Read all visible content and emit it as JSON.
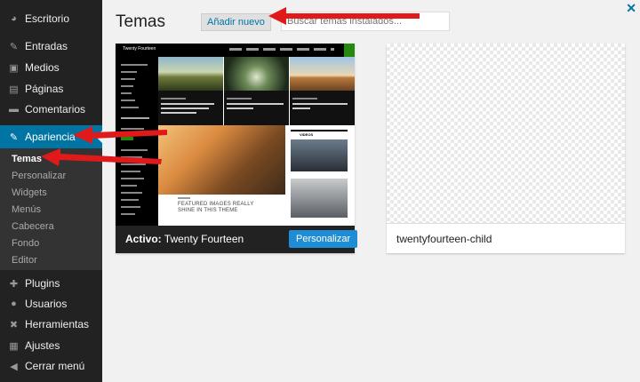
{
  "sidebar": {
    "items": [
      {
        "label": "Escritorio",
        "icon": "dashboard-icon",
        "glyph": "◕"
      },
      {
        "label": "Entradas",
        "icon": "pin-icon",
        "glyph": "✎"
      },
      {
        "label": "Medios",
        "icon": "media-icon",
        "glyph": "▣"
      },
      {
        "label": "Páginas",
        "icon": "pages-icon",
        "glyph": "▤"
      },
      {
        "label": "Comentarios",
        "icon": "comments-icon",
        "glyph": "▬"
      },
      {
        "label": "Apariencia",
        "icon": "appearance-icon",
        "glyph": "✎"
      },
      {
        "label": "Plugins",
        "icon": "plugins-icon",
        "glyph": "✚"
      },
      {
        "label": "Usuarios",
        "icon": "users-icon",
        "glyph": "●"
      },
      {
        "label": "Herramientas",
        "icon": "tools-icon",
        "glyph": "✖"
      },
      {
        "label": "Ajustes",
        "icon": "settings-icon",
        "glyph": "▦"
      },
      {
        "label": "Cerrar menú",
        "icon": "collapse-icon",
        "glyph": "◀"
      }
    ],
    "submenu": [
      "Temas",
      "Personalizar",
      "Widgets",
      "Menús",
      "Cabecera",
      "Fondo",
      "Editor"
    ]
  },
  "header": {
    "title": "Temas",
    "add_new_label": "Añadir nuevo",
    "search_placeholder": "Buscar temas instalados..."
  },
  "themes": {
    "active": {
      "prefix": "Activo:",
      "name": "Twenty Fourteen",
      "customize_label": "Personalizar",
      "preview": {
        "site_name": "Twenty Fourteen",
        "feature_headline_1": "FEATURED IMAGES REALLY",
        "feature_headline_2": "SHINE IN THIS THEME",
        "videos_label": "VIDEOS"
      }
    },
    "child": {
      "name": "twentyfourteen-child"
    }
  },
  "colors": {
    "sidebar_bg": "#222222",
    "accent": "#0074a2",
    "button_blue": "#1f8dd6",
    "arrow_red": "#e0191b"
  }
}
